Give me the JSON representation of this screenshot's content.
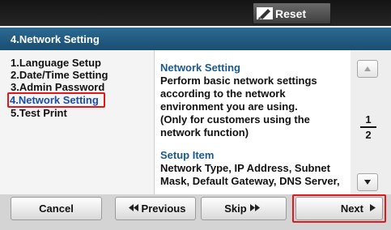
{
  "toolbar": {
    "reset_label": "Reset",
    "reset_icon": "reset-pencil-icon"
  },
  "header": {
    "title": "4.Network Setting"
  },
  "menu": {
    "items": [
      "1.Language Setup",
      "2.Date/Time Setting",
      "3.Admin Password",
      "4.Network Setting",
      "5.Test Print"
    ],
    "selected_index": 3
  },
  "content": {
    "heading1": "Network Setting",
    "body1": "Perform basic network settings\naccording to the network\nenvironment you are using.\n  (Only for customers using the\nnetwork function)",
    "heading2": "Setup Item",
    "body2": "Network Type, IP Address, Subnet\nMask, Default Gateway, DNS Server,"
  },
  "pager": {
    "current": "1",
    "total": "2"
  },
  "footer": {
    "cancel_label": "Cancel",
    "previous_label": "Previous",
    "skip_label": "Skip",
    "next_label": "Next"
  },
  "colors": {
    "accent": "#1b4e72",
    "highlight": "#e0191c",
    "link_text": "#1b4ea8"
  }
}
